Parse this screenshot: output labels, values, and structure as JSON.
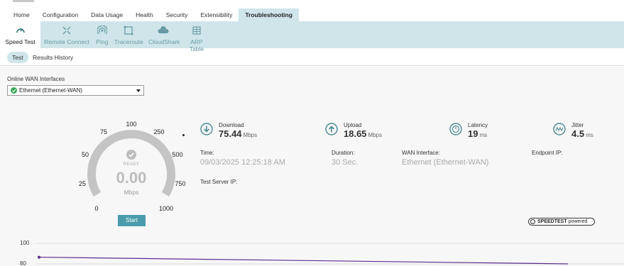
{
  "nav": {
    "items": [
      "Home",
      "Configuration",
      "Data Usage",
      "Health",
      "Security",
      "Extensibility",
      "Troubleshooting"
    ],
    "active": "Troubleshooting"
  },
  "subnav": {
    "items": [
      {
        "label": "Speed Test",
        "icon": "gauge-icon"
      },
      {
        "label": "Remote Connect",
        "icon": "remote-connect-icon"
      },
      {
        "label": "Ping",
        "icon": "ping-icon"
      },
      {
        "label": "Traceroute",
        "icon": "traceroute-icon"
      },
      {
        "label": "CloudShark",
        "icon": "cloudshark-icon"
      },
      {
        "label": "ARP Table",
        "icon": "table-icon"
      }
    ],
    "active": "Speed Test"
  },
  "tabs": {
    "test": "Test",
    "history": "Results History"
  },
  "wan": {
    "label": "Online WAN Interfaces",
    "selected": "Ethernet (Ethernet-WAN)"
  },
  "gauge": {
    "ticks": [
      "0",
      "25",
      "50",
      "75",
      "100",
      "250",
      "500",
      "750",
      "1000"
    ],
    "status": "READY",
    "value": "0.00",
    "unit": "Mbps",
    "start_label": "Start"
  },
  "metrics": {
    "download": {
      "label": "Download",
      "value": "75.44",
      "unit": "Mbps"
    },
    "upload": {
      "label": "Upload",
      "value": "18.65",
      "unit": "Mbps"
    },
    "latency": {
      "label": "Latency",
      "value": "19",
      "unit": "ms"
    },
    "jitter": {
      "label": "Jitter",
      "value": "4.5",
      "unit": "ms"
    }
  },
  "info": {
    "time_label": "Time:",
    "time_value": "09/03/2025 12:25:18 AM",
    "duration_label": "Duration:",
    "duration_value": "30 Sec.",
    "wan_label": "WAN Interface:",
    "wan_value": "Ethernet (Ethernet-WAN)",
    "endpoint_label": "Endpoint IP:",
    "server_label": "Test Server IP:"
  },
  "badge": {
    "brand": "SPEEDTEST",
    "suffix": "powered"
  },
  "chart_data": {
    "type": "line",
    "y_ticks": [
      "100",
      "80"
    ],
    "ylim": [
      80,
      100
    ],
    "series": [
      {
        "points": [
          [
            0,
            86.5
          ],
          [
            1,
            80
          ]
        ]
      }
    ],
    "color": "#5a2d8c"
  },
  "colors": {
    "accent": "#4a9bab",
    "subnav_bg": "#cfe5ea",
    "active_text": "#1c6b78"
  }
}
